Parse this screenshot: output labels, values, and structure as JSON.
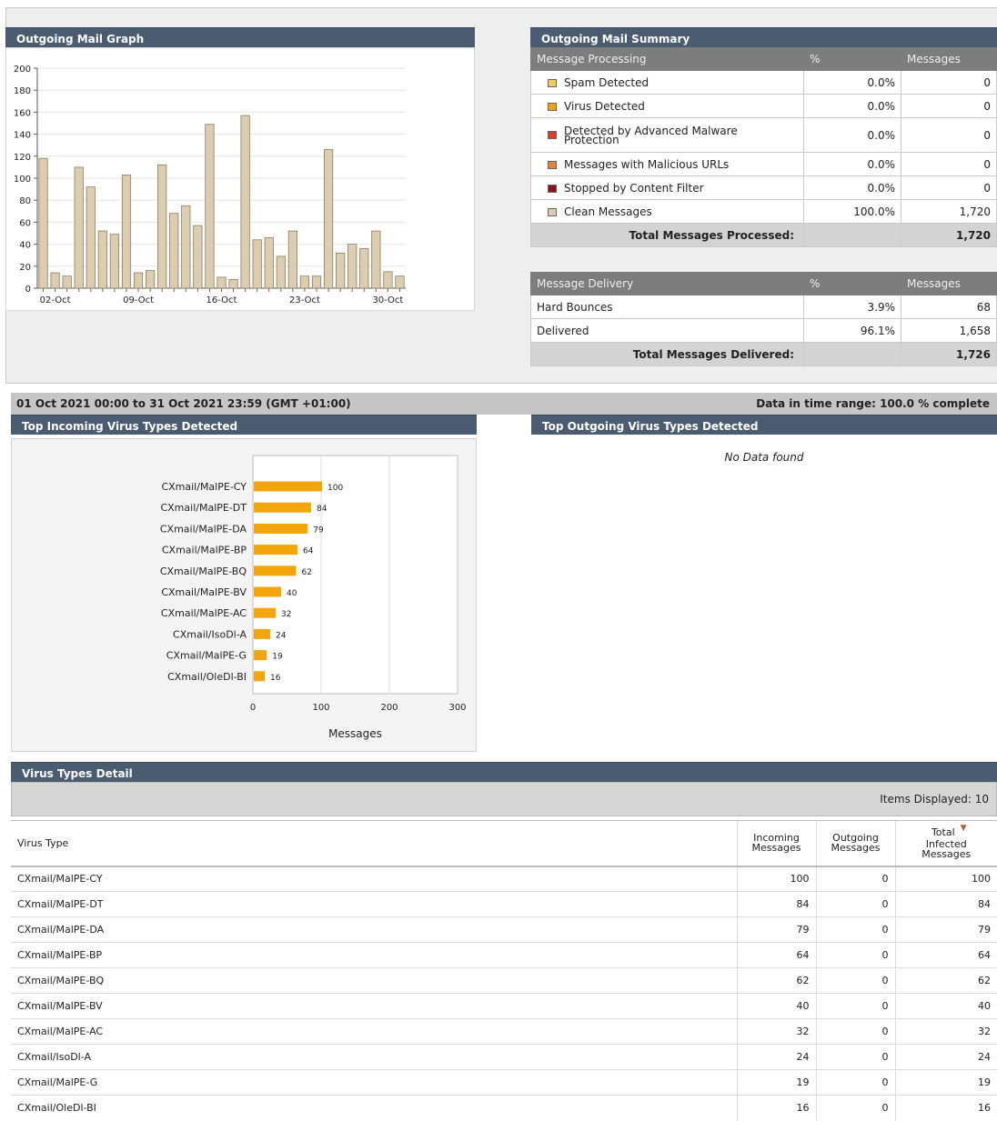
{
  "outgoing_graph": {
    "title": "Outgoing Mail Graph",
    "chart_data": {
      "type": "bar",
      "values": [
        118,
        14,
        11,
        110,
        92,
        52,
        49,
        103,
        14,
        16,
        112,
        68,
        75,
        57,
        149,
        10,
        8,
        157,
        44,
        46,
        29,
        52,
        11,
        11,
        126,
        32,
        40,
        36,
        52,
        15,
        11
      ],
      "xtick_labels": [
        "02-Oct",
        "09-Oct",
        "16-Oct",
        "23-Oct",
        "30-Oct"
      ],
      "xtick_positions": [
        2,
        9,
        16,
        23,
        30
      ],
      "yticks": [
        0,
        20,
        40,
        60,
        80,
        100,
        120,
        140,
        160,
        180,
        200
      ],
      "ylim": [
        0,
        200
      ],
      "bar_color": "#dccdb0",
      "grid": true
    }
  },
  "summary": {
    "title": "Outgoing Mail Summary",
    "processing_header": {
      "col1": "Message Processing",
      "col2": "%",
      "col3": "Messages"
    },
    "processing_rows": [
      {
        "label": "Spam Detected",
        "pct": "0.0%",
        "count": "0",
        "color": "#f2cc63"
      },
      {
        "label": "Virus Detected",
        "pct": "0.0%",
        "count": "0",
        "color": "#f0a415"
      },
      {
        "label": "Detected by Advanced Malware Protection",
        "pct": "0.0%",
        "count": "0",
        "color": "#d93f2d"
      },
      {
        "label": "Messages with Malicious URLs",
        "pct": "0.0%",
        "count": "0",
        "color": "#e7803a"
      },
      {
        "label": "Stopped by Content Filter",
        "pct": "0.0%",
        "count": "0",
        "color": "#8b1018"
      },
      {
        "label": "Clean Messages",
        "pct": "100.0%",
        "count": "1,720",
        "color": "#dccdb0"
      }
    ],
    "processing_total": {
      "label": "Total Messages Processed:",
      "count": "1,720"
    },
    "delivery_header": {
      "col1": "Message Delivery",
      "col2": "%",
      "col3": "Messages"
    },
    "delivery_rows": [
      {
        "label": "Hard Bounces",
        "pct": "3.9%",
        "count": "68"
      },
      {
        "label": "Delivered",
        "pct": "96.1%",
        "count": "1,658"
      }
    ],
    "delivery_total": {
      "label": "Total Messages Delivered:",
      "count": "1,726"
    }
  },
  "range": {
    "text": "01 Oct 2021 00:00 to 31 Oct 2021 23:59 (GMT +01:00)",
    "complete": "Data in time range: 100.0 % complete"
  },
  "incoming_virus": {
    "title": "Top Incoming Virus Types Detected",
    "chart_data": {
      "type": "bar",
      "orientation": "horizontal",
      "categories": [
        "CXmail/MalPE-CY",
        "CXmail/MalPE-DT",
        "CXmail/MalPE-DA",
        "CXmail/MalPE-BP",
        "CXmail/MalPE-BQ",
        "CXmail/MalPE-BV",
        "CXmail/MalPE-AC",
        "CXmail/IsoDl-A",
        "CXmail/MalPE-G",
        "CXmail/OleDl-BI"
      ],
      "values": [
        100,
        84,
        79,
        64,
        62,
        40,
        32,
        24,
        19,
        16
      ],
      "xticks": [
        0,
        100,
        200,
        300
      ],
      "xlim": [
        0,
        300
      ],
      "xlabel": "Messages",
      "bar_color": "#f2a60c"
    }
  },
  "outgoing_virus": {
    "title": "Top Outgoing Virus Types Detected",
    "empty_text": "No Data found"
  },
  "detail": {
    "title": "Virus Types Detail",
    "items_displayed": "Items Displayed: 10",
    "columns": {
      "virus_type": "Virus Type",
      "incoming": [
        "Incoming",
        "Messages"
      ],
      "outgoing": [
        "Outgoing",
        "Messages"
      ],
      "total": [
        "Total",
        "Infected",
        "Messages"
      ]
    },
    "rows": [
      {
        "name": "CXmail/MalPE-CY",
        "incoming": "100",
        "outgoing": "0",
        "total": "100"
      },
      {
        "name": "CXmail/MalPE-DT",
        "incoming": "84",
        "outgoing": "0",
        "total": "84"
      },
      {
        "name": "CXmail/MalPE-DA",
        "incoming": "79",
        "outgoing": "0",
        "total": "79"
      },
      {
        "name": "CXmail/MalPE-BP",
        "incoming": "64",
        "outgoing": "0",
        "total": "64"
      },
      {
        "name": "CXmail/MalPE-BQ",
        "incoming": "62",
        "outgoing": "0",
        "total": "62"
      },
      {
        "name": "CXmail/MalPE-BV",
        "incoming": "40",
        "outgoing": "0",
        "total": "40"
      },
      {
        "name": "CXmail/MalPE-AC",
        "incoming": "32",
        "outgoing": "0",
        "total": "32"
      },
      {
        "name": "CXmail/IsoDl-A",
        "incoming": "24",
        "outgoing": "0",
        "total": "24"
      },
      {
        "name": "CXmail/MalPE-G",
        "incoming": "19",
        "outgoing": "0",
        "total": "19"
      },
      {
        "name": "CXmail/OleDl-BI",
        "incoming": "16",
        "outgoing": "0",
        "total": "16"
      }
    ]
  }
}
